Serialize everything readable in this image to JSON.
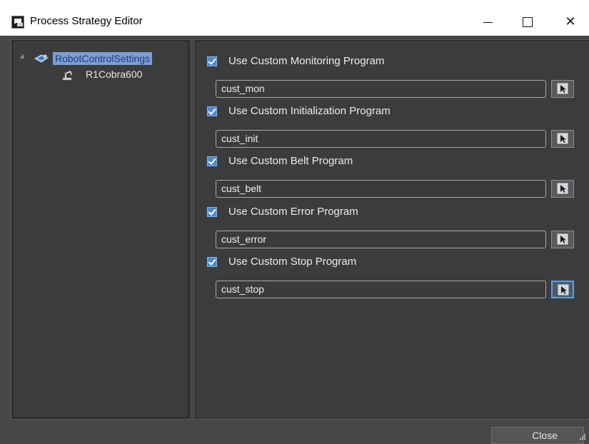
{
  "window": {
    "title": "Process Strategy Editor",
    "icon": "process-strategy-app-icon",
    "controls": [
      "minimize",
      "maximize",
      "close"
    ],
    "close_glyph": "✕"
  },
  "tree": {
    "root": {
      "label": "RobotControlSettings",
      "icon": "robot-settings-icon",
      "expanded": true,
      "selected": true
    },
    "children": [
      {
        "label": "R1Cobra600",
        "icon": "robot-arm-icon"
      }
    ]
  },
  "options": [
    {
      "label": "Use Custom Monitoring Program",
      "checked": true,
      "value": "cust_mon"
    },
    {
      "label": "Use Custom Initialization Program",
      "checked": true,
      "value": "cust_init"
    },
    {
      "label": "Use Custom Belt Program",
      "checked": true,
      "value": "cust_belt"
    },
    {
      "label": "Use Custom Error Program",
      "checked": true,
      "value": "cust_error"
    },
    {
      "label": "Use Custom Stop Program",
      "checked": true,
      "value": "cust_stop"
    }
  ],
  "footer": {
    "close_label": "Close"
  },
  "colors": {
    "background": "#474747",
    "pane": "#3c3c3c",
    "selection": "#7b9fd4",
    "checkbox": "#4c8bd0",
    "focus": "#5aa0e6"
  }
}
